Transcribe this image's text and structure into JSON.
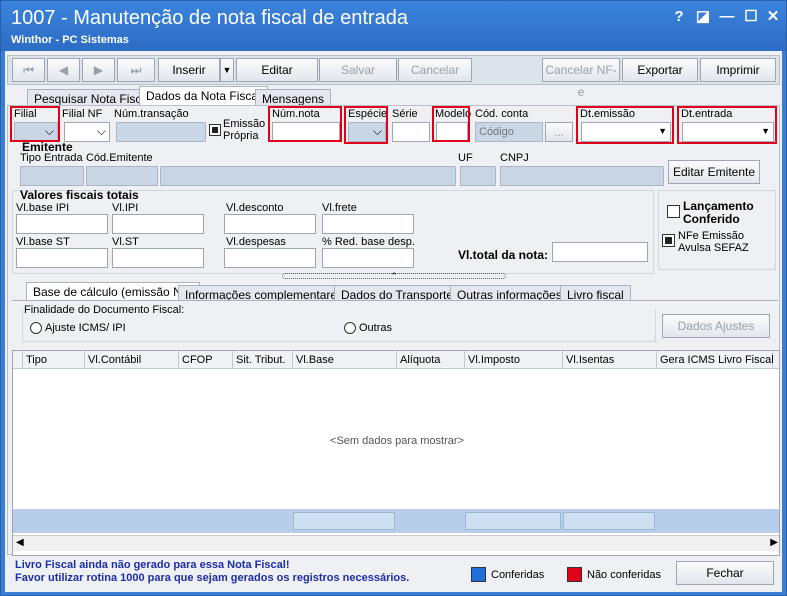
{
  "window": {
    "title": "1007 - Manutenção de nota fiscal de entrada",
    "subtitle": "Winthor - PC Sistemas",
    "controls": [
      "?",
      "◪",
      "—",
      "☐",
      "✕"
    ]
  },
  "toolbar": {
    "nav": [
      "⏮",
      "◀",
      "▶",
      "⏭"
    ],
    "inserir": "Inserir",
    "editar": "Editar",
    "salvar": "Salvar",
    "cancelar": "Cancelar",
    "cancelar_nfe": "Cancelar NF-e",
    "exportar": "Exportar",
    "imprimir": "Imprimir"
  },
  "main_tabs": [
    "Pesquisar Nota Fiscal",
    "Dados da Nota Fiscal",
    "Mensagens"
  ],
  "fields": {
    "filial": "Filial",
    "filial_nf": "Filial NF",
    "num_transacao": "Núm.transação",
    "emissao_propria": "Emissão\nPrópria",
    "num_nota": "Núm.nota",
    "especie": "Espécie",
    "serie": "Série",
    "modelo": "Modelo",
    "cod_conta": "Cód. conta",
    "codigo_placeholder": "Código",
    "ellipsis": "...",
    "dt_emissao": "Dt.emissão",
    "dt_entrada": "Dt.entrada"
  },
  "emitente": {
    "title": "Emitente",
    "tipo_entrada": "Tipo Entrada",
    "cod_emitente": "Cód.Emitente",
    "uf": "UF",
    "cnpj": "CNPJ",
    "editar": "Editar Emitente"
  },
  "valores": {
    "title": "Valores fiscais totais",
    "vl_base_ipi": "Vl.base IPI",
    "vl_ipi": "Vl.IPI",
    "vl_desconto": "Vl.desconto",
    "vl_frete": "Vl.frete",
    "vl_base_st": "Vl.base ST",
    "vl_st": "Vl.ST",
    "vl_despesas": "Vl.despesas",
    "red_base": "% Red. base desp.",
    "vl_total": "Vl.total da nota:"
  },
  "flags": {
    "lancamento": "Lançamento\nConferido",
    "nfe_avulsa": "NFe Emissão\nAvulsa SEFAZ"
  },
  "sub_tabs": [
    "Base de cálculo (emissão NF)",
    "Informações complementares",
    "Dados do Transporte",
    "Outras informações",
    "Livro fiscal"
  ],
  "finalidade": {
    "title": "Finalidade do Documento Fiscal:",
    "opt1": "Ajuste ICMS/ IPI",
    "opt2": "Outras",
    "dados_ajustes": "Dados Ajustes"
  },
  "grid": {
    "columns": [
      "Tipo",
      "Vl.Contábil",
      "CFOP",
      "Sit. Tribut.",
      "Vl.Base",
      "Alíquota",
      "Vl.Imposto",
      "Vl.Isentas",
      "Gera ICMS Livro Fiscal"
    ],
    "empty": "<Sem dados para mostrar>"
  },
  "footer": {
    "msg1": "Livro Fiscal ainda não gerado para essa Nota Fiscal!",
    "msg2": "Favor utilizar rotina 1000 para que sejam gerados os registros necessários.",
    "conferidas": "Conferidas",
    "nao_conferidas": "Não conferidas",
    "fechar": "Fechar",
    "color_conferidas": "#1e6fd9",
    "color_nao": "#e0001b"
  }
}
